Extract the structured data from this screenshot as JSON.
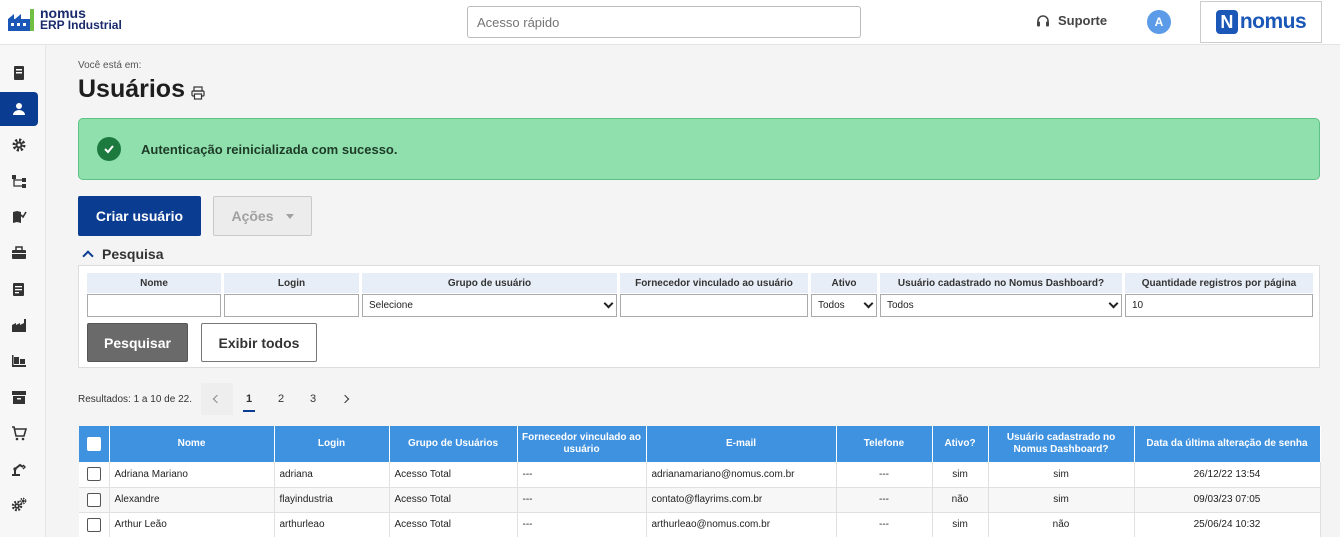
{
  "app": {
    "logo_line1": "nomus",
    "logo_line2": "ERP Industrial",
    "quick_access_placeholder": "Acesso rápido",
    "support_label": "Suporte",
    "avatar_initial": "A",
    "brand_text": "nomus",
    "brand_letter": "N"
  },
  "sidebar": {
    "items": [
      {
        "icon": "document-stack-icon"
      },
      {
        "icon": "user-icon",
        "active": true
      },
      {
        "icon": "gear-icon"
      },
      {
        "icon": "hierarchy-icon"
      },
      {
        "icon": "map-check-icon"
      },
      {
        "icon": "briefcase-icon"
      },
      {
        "icon": "clipboard-icon"
      },
      {
        "icon": "factory-icon"
      },
      {
        "icon": "pallet-icon"
      },
      {
        "icon": "archive-icon"
      },
      {
        "icon": "cart-icon"
      },
      {
        "icon": "robot-arm-icon"
      },
      {
        "icon": "gears-icon"
      }
    ]
  },
  "page": {
    "breadcrumb_label": "Você está em:",
    "title": "Usuários",
    "alert_message": "Autenticação reinicializada com sucesso."
  },
  "actions": {
    "create_user": "Criar usuário",
    "actions_menu": "Ações"
  },
  "search": {
    "heading": "Pesquisa",
    "fields": {
      "name": {
        "label": "Nome",
        "value": ""
      },
      "login": {
        "label": "Login",
        "value": ""
      },
      "group": {
        "label": "Grupo de usuário",
        "value": "Selecione"
      },
      "supplier": {
        "label": "Fornecedor vinculado ao usuário",
        "value": ""
      },
      "active": {
        "label": "Ativo",
        "value": "Todos"
      },
      "dashboard": {
        "label": "Usuário cadastrado no Nomus Dashboard?",
        "value": "Todos"
      },
      "per_page": {
        "label": "Quantidade registros por página",
        "value": "10"
      }
    },
    "search_button": "Pesquisar",
    "show_all_button": "Exibir todos"
  },
  "results": {
    "summary": "Resultados: 1 a 10 de 22.",
    "pages": [
      "1",
      "2",
      "3"
    ],
    "current_page": "1"
  },
  "table": {
    "columns": [
      "Nome",
      "Login",
      "Grupo de Usuários",
      "Fornecedor vinculado ao usuário",
      "E-mail",
      "Telefone",
      "Ativo?",
      "Usuário cadastrado no Nomus Dashboard?",
      "Data da última alteração de senha"
    ],
    "rows": [
      [
        "Adriana Mariano",
        "adriana",
        "Acesso Total",
        "---",
        "adrianamariano@nomus.com.br",
        "---",
        "sim",
        "sim",
        "26/12/22 13:54"
      ],
      [
        "Alexandre",
        "flayindustria",
        "Acesso Total",
        "---",
        "contato@flayrims.com.br",
        "---",
        "não",
        "sim",
        "09/03/23 07:05"
      ],
      [
        "Arthur Leão",
        "arthurleao",
        "Acesso Total",
        "---",
        "arthurleao@nomus.com.br",
        "---",
        "sim",
        "não",
        "25/06/24 10:32"
      ]
    ]
  },
  "colors": {
    "primary": "#0a3c91",
    "header_blue": "#3f92e0",
    "alert_bg": "#90e0ae",
    "alert_icon": "#1c7a3e"
  }
}
